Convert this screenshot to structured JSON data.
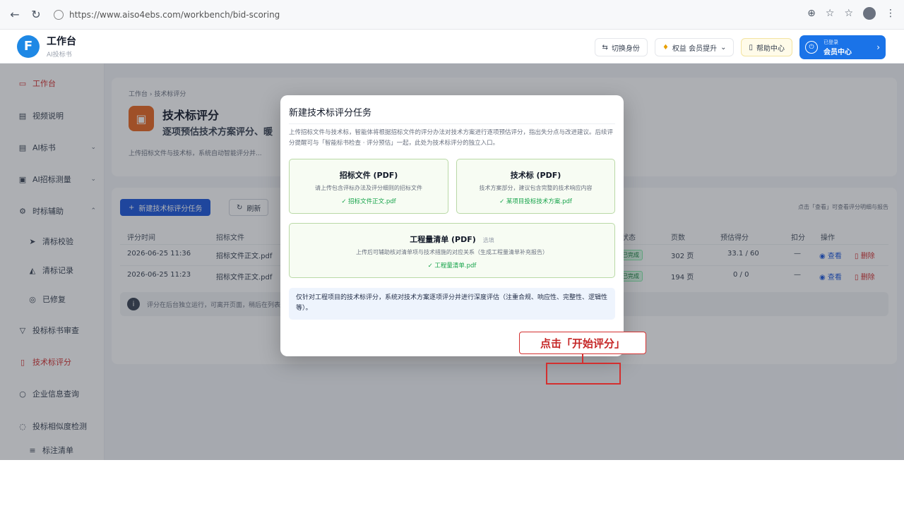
{
  "browser": {
    "url": "https://www.aiso4ebs.com/workbench/bid-scoring"
  },
  "header": {
    "app_title": "工作台",
    "app_subtitle": "AI投标书",
    "switch_label": "切换身份",
    "member_level_label": "权益 会员提升",
    "help_label": "帮助中心",
    "member_center_small": "已登录",
    "member_center_label": "会员中心"
  },
  "sidebar": {
    "items": [
      {
        "label": "工作台",
        "icon": "monitor-icon"
      },
      {
        "label": "视频说明",
        "icon": "doc-icon"
      },
      {
        "label": "AI标书",
        "icon": "file-icon"
      },
      {
        "label": "AI招标测量",
        "icon": "box-icon"
      },
      {
        "label": "时标辅助",
        "icon": "gear-icon"
      },
      {
        "label": "清标校验",
        "icon": "send-icon"
      },
      {
        "label": "清标记录",
        "icon": "chart-icon"
      },
      {
        "label": "已修复",
        "icon": "check-circle-icon"
      },
      {
        "label": "投标标书审查",
        "icon": "filter-icon"
      },
      {
        "label": "技术标评分",
        "icon": "doc-icon"
      },
      {
        "label": "企业信息查询",
        "icon": "search-icon"
      },
      {
        "label": "投标相似度检测",
        "icon": "chat-icon"
      },
      {
        "label": "标注清单",
        "icon": "list-icon"
      }
    ]
  },
  "hero": {
    "breadcrumb": "工作台 › 技术标评分",
    "title": "技术标评分",
    "subtitle": "逐项预估技术方案评分、暖",
    "description": "上传招标文件与技术标，系统自动智能评分并..."
  },
  "list": {
    "new_button": "新建技术标评分任务",
    "refresh_button": "刷新",
    "hint": "点击「查看」可查看评分明细与报告",
    "columns": [
      "评分时间",
      "招标文件",
      "状态",
      "页数",
      "预估得分",
      "扣分",
      "操作"
    ],
    "rows": [
      {
        "time": "2026-06-25 11:36",
        "file": "招标文件正文.pdf",
        "status": "已完成",
        "pages": "302 页",
        "score": "33.1 / 60",
        "deduct": "—",
        "view": "查看",
        "delete": "删除"
      },
      {
        "time": "2026-06-25 11:23",
        "file": "招标文件正文.pdf",
        "status": "已完成",
        "pages": "194 页",
        "score": "0 / 0",
        "deduct": "—",
        "view": "查看",
        "delete": "删除"
      }
    ],
    "notice": "评分在后台独立运行，可离开页面，稍后在列表查看结果。"
  },
  "modal": {
    "title": "新建技术标评分任务",
    "description": "上传招标文件与技术标，智能体将根据招标文件的评分办法对技术方案进行逐项预估评分，指出失分点与改进建议。后续评分提醒可与「智能标书检查 · 评分预估」一起，此处为技术标评分的独立入口。",
    "uploads": [
      {
        "title": "招标文件 (PDF)",
        "hint": "请上传包含评标办法及评分细则的招标文件",
        "file": "✓ 招标文件正文.pdf"
      },
      {
        "title": "技术标 (PDF)",
        "hint": "技术方案部分，建议包含完整的技术响应内容",
        "file": "✓ 某项目投标技术方案.pdf"
      },
      {
        "title": "工程量清单 (PDF)",
        "optional": "选填",
        "hint": "上传后可辅助核对清单项与技术措施的对应关系（生成工程量清单补充报告）",
        "file": "✓ 工程量清单.pdf"
      }
    ],
    "info": "仅针对工程项目的技术标评分，系统对技术方案逐项评分并进行深度评估（注重合规、响应性、完整性、逻辑性等）。"
  },
  "annotation": {
    "label": "点击「开始评分」"
  },
  "colors": {
    "primary": "#1a56db",
    "accent_red": "#d32f2f",
    "success": "#16a34a"
  }
}
